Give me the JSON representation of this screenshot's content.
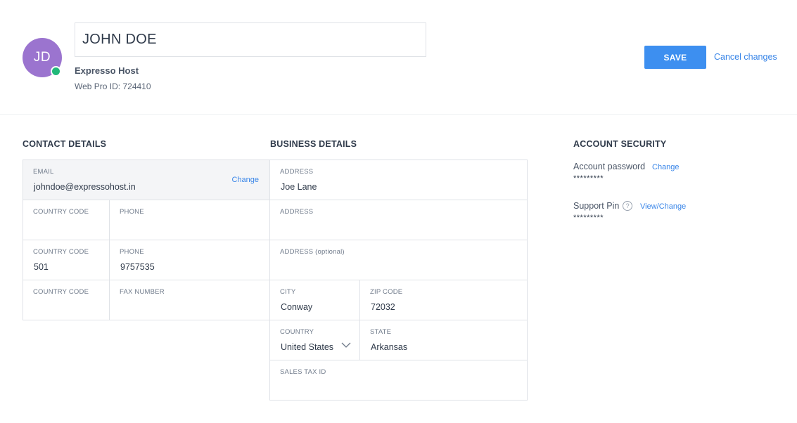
{
  "profile": {
    "initials": "JD",
    "name": "JOHN DOE",
    "company": "Expresso Host",
    "web_pro_id": "Web Pro ID: 724410",
    "status_color": "#21b879",
    "avatar_color": "#9b74cf"
  },
  "actions": {
    "save_label": "SAVE",
    "cancel_label": "Cancel changes"
  },
  "contact": {
    "title": "CONTACT DETAILS",
    "email_label": "EMAIL",
    "email_value": "johndoe@expressohost.in",
    "email_change": "Change",
    "rows": [
      {
        "code_label": "COUNTRY CODE",
        "code_value": "",
        "field_label": "PHONE",
        "field_value": ""
      },
      {
        "code_label": "COUNTRY CODE",
        "code_value": "501",
        "field_label": "PHONE",
        "field_value": "9757535"
      },
      {
        "code_label": "COUNTRY CODE",
        "code_value": "",
        "field_label": "FAX NUMBER",
        "field_value": ""
      }
    ]
  },
  "business": {
    "title": "BUSINESS DETAILS",
    "address1_label": "ADDRESS",
    "address1_value": "Joe Lane",
    "address2_label": "ADDRESS",
    "address2_value": "",
    "address3_label": "ADDRESS (optional)",
    "address3_value": "",
    "city_label": "CITY",
    "city_value": "Conway",
    "zip_label": "ZIP CODE",
    "zip_value": "72032",
    "country_label": "COUNTRY",
    "country_value": "United States",
    "state_label": "STATE",
    "state_value": "Arkansas",
    "tax_label": "SALES TAX ID",
    "tax_value": ""
  },
  "security": {
    "title": "ACCOUNT SECURITY",
    "password_label": "Account password",
    "password_link": "Change",
    "password_mask": "*********",
    "pin_label": "Support Pin",
    "pin_help": "?",
    "pin_link": "View/Change",
    "pin_mask": "*********"
  },
  "colors": {
    "accent": "#3d8ff0",
    "link": "#3a86e8",
    "border": "#dfe2e7"
  }
}
